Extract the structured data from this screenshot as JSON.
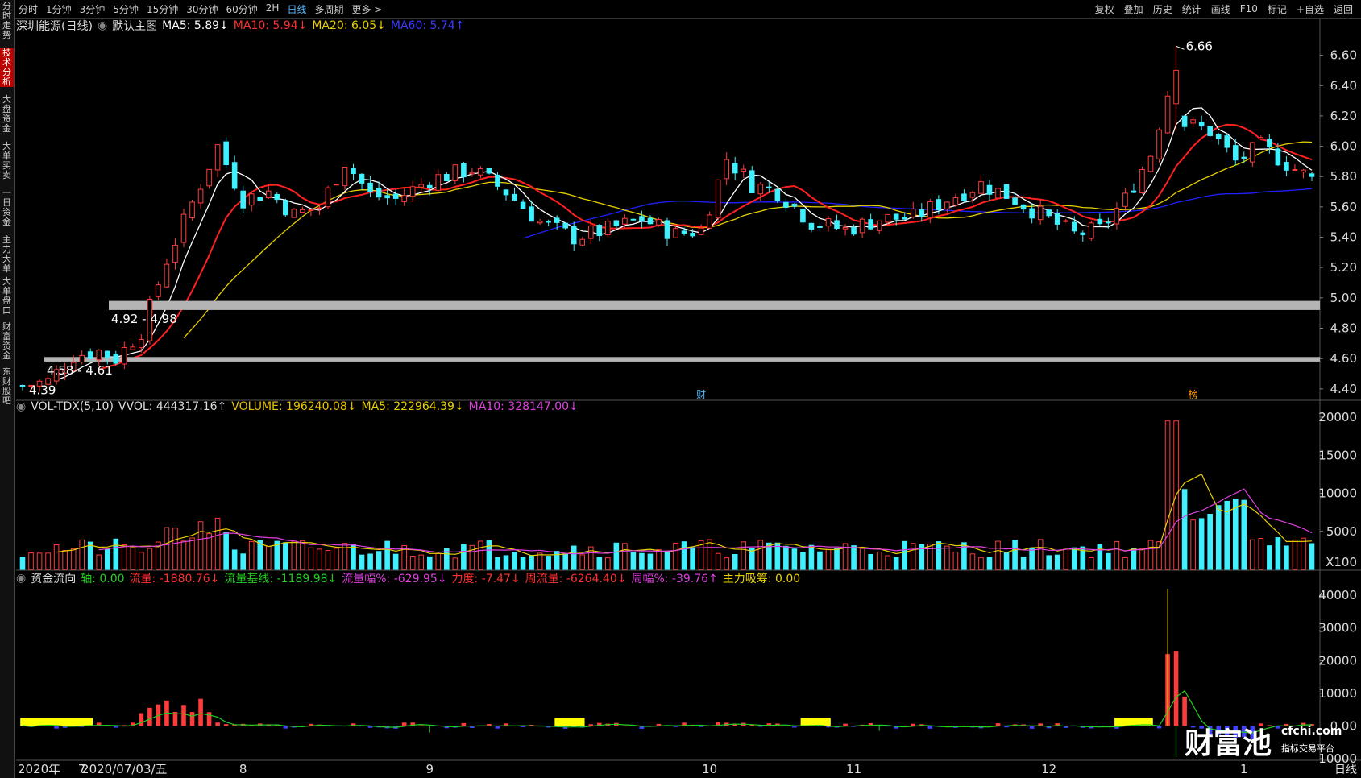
{
  "periods": [
    {
      "label": "分时",
      "active": false
    },
    {
      "label": "1分钟",
      "active": false
    },
    {
      "label": "3分钟",
      "active": false
    },
    {
      "label": "5分钟",
      "active": false
    },
    {
      "label": "15分钟",
      "active": false
    },
    {
      "label": "30分钟",
      "active": false
    },
    {
      "label": "60分钟",
      "active": false
    },
    {
      "label": "2H",
      "active": false
    },
    {
      "label": "日线",
      "active": true
    },
    {
      "label": "多周期",
      "active": false
    },
    {
      "label": "更多 >",
      "active": false
    }
  ],
  "toolbar": [
    "复权",
    "叠加",
    "历史",
    "统计",
    "画线",
    "F10",
    "标记",
    "+自选",
    "返回"
  ],
  "sidebar": [
    {
      "label": "分时走势",
      "active": false
    },
    {
      "label": "技术分析",
      "active": true
    },
    {
      "label": "大盘资金",
      "active": false
    },
    {
      "label": "大单买卖",
      "active": false
    },
    {
      "label": "一日资金",
      "active": false
    },
    {
      "label": "主力大单",
      "active": false
    },
    {
      "label": "大单盘口",
      "active": false
    },
    {
      "label": "财富资金",
      "active": false
    },
    {
      "label": "东财股吧",
      "active": false
    }
  ],
  "main_legend": {
    "title": "深圳能源(日线)",
    "template": "默认主图",
    "ma5": "MA5: 5.89↓",
    "ma10": "MA10: 5.94↓",
    "ma20": "MA20: 6.05↓",
    "ma60": "MA60: 5.74↑"
  },
  "vol_legend": {
    "name": "VOL-TDX(5,10)",
    "vvol": "VVOL: 444317.16↑",
    "volume": "VOLUME: 196240.08↓",
    "ma5": "MA5: 222964.39↓",
    "ma10": "MA10: 328147.00↓"
  },
  "flow_legend": {
    "name": "资金流向",
    "axis": "轴: 0.00",
    "flow": "流量: -1880.76↓",
    "base": "流量基线: -1189.98↓",
    "amp": "流量幅%: -629.95↓",
    "force": "力度: -7.47↓",
    "week": "周流量: -6264.40↓",
    "weekamp": "周幅%: -39.76↑",
    "absorb": "主力吸筹: 0.00"
  },
  "colors": {
    "up": "#ff3c3c",
    "down": "#3ff0ff",
    "ma5": "#ffffff",
    "ma10": "#ff2020",
    "ma20": "#e8d000",
    "ma60": "#2020ff",
    "purple": "#e040e0",
    "green": "#20d020",
    "yellow": "#ffff00"
  },
  "chart_data": {
    "type": "candlestick",
    "price_axis": {
      "ylim": [
        4.33,
        6.72
      ],
      "ticks": [
        "6.60",
        "6.40",
        "6.20",
        "6.00",
        "5.80",
        "5.60",
        "5.40",
        "5.20",
        "5.00",
        "4.80",
        "4.60",
        "4.40"
      ]
    },
    "volume_axis": {
      "ylim": [
        0,
        20000
      ],
      "ticks": [
        "20000",
        "15000",
        "10000",
        "5000"
      ],
      "unit": "X100"
    },
    "flow_axis": {
      "ylim": [
        -10000,
        42000
      ],
      "ticks": [
        "40000",
        "30000",
        "20000",
        "10000",
        "0.00",
        "10000"
      ]
    },
    "annotations": {
      "high_label": "6.66",
      "low_label": "4.39",
      "zone_low_label": "4.58 - 4.61",
      "zone_high_label": "4.92 - 4.98",
      "zone_low": [
        4.58,
        4.61
      ],
      "zone_high": [
        4.92,
        4.98
      ],
      "event_markers": [
        "财",
        "榜"
      ]
    },
    "x_axis_labels": [
      "2020年",
      "7",
      "2020/07/03/五",
      "8",
      "9",
      "10",
      "11",
      "12",
      "1"
    ],
    "x_axis_right": "日线",
    "watermark": {
      "brand": "财富池",
      "site": "cfchi.com",
      "slogan": "指标交易平台"
    },
    "ohlcv_desc": "~143 daily candles from mid-June 2020 to late January 2021; generated path matches visible price contour",
    "series": [
      {
        "name": "MA5",
        "values": []
      },
      {
        "name": "MA10",
        "values": []
      },
      {
        "name": "MA20",
        "values": []
      },
      {
        "name": "MA60",
        "values": []
      }
    ]
  }
}
